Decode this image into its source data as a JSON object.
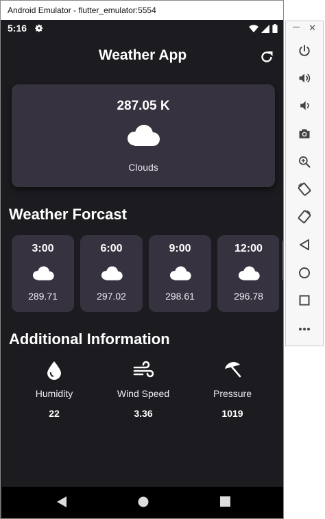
{
  "window": {
    "title": "Android Emulator - flutter_emulator:5554"
  },
  "status_bar": {
    "time": "5:16"
  },
  "app_bar": {
    "title": "Weather App"
  },
  "current": {
    "temperature": "287.05 K",
    "condition": "Clouds",
    "icon": "cloud-icon"
  },
  "forecast": {
    "title": "Weather Forcast",
    "items": [
      {
        "time": "3:00",
        "temp": "289.71",
        "icon": "cloud-icon"
      },
      {
        "time": "6:00",
        "temp": "297.02",
        "icon": "cloud-icon"
      },
      {
        "time": "9:00",
        "temp": "298.61",
        "icon": "cloud-icon"
      },
      {
        "time": "12:00",
        "temp": "296.78",
        "icon": "cloud-icon"
      }
    ]
  },
  "additional": {
    "title": "Additional Information",
    "items": [
      {
        "label": "Humidity",
        "value": "22",
        "icon": "water-drop-icon"
      },
      {
        "label": "Wind Speed",
        "value": "3.36",
        "icon": "wind-icon"
      },
      {
        "label": "Pressure",
        "value": "1019",
        "icon": "umbrella-icon"
      }
    ]
  },
  "colors": {
    "background": "#1c1b1f",
    "card": "#37323f",
    "text": "#ffffff"
  }
}
